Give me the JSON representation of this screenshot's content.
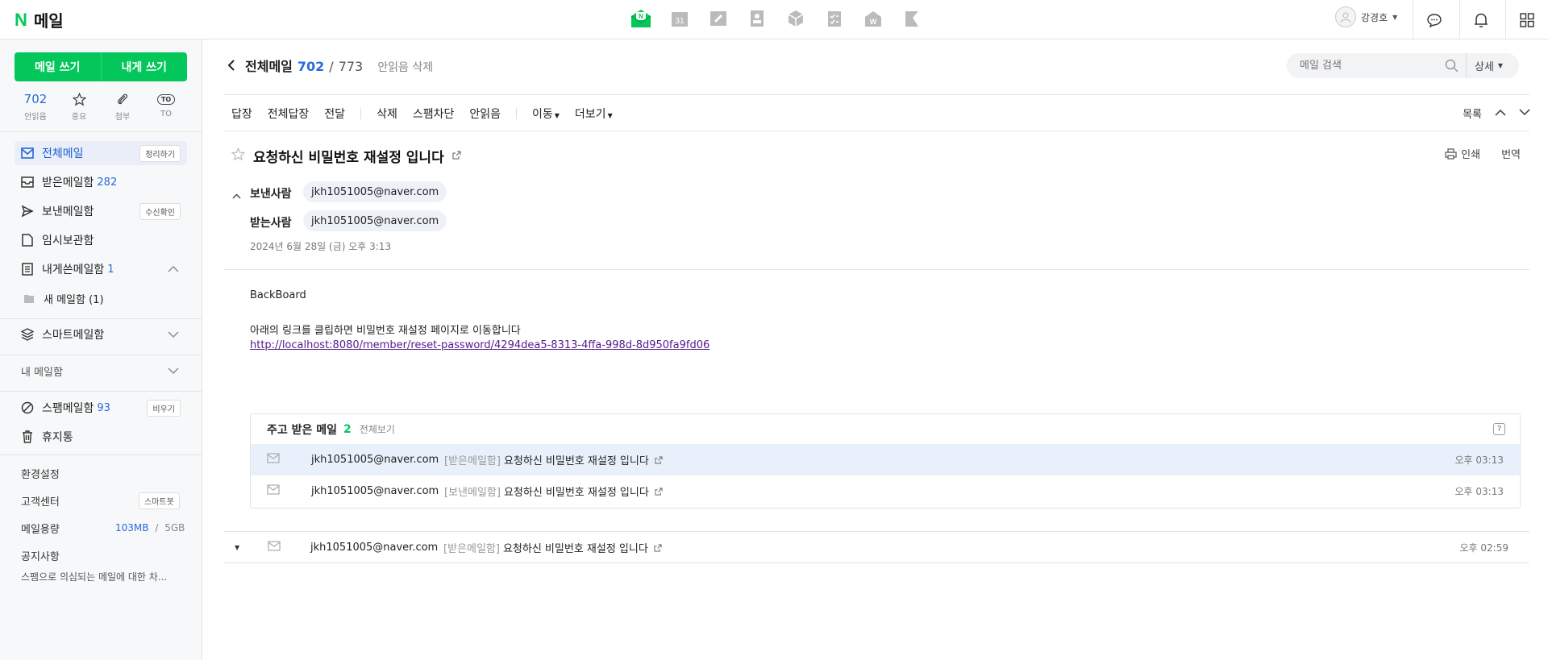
{
  "app": {
    "logo_n": "N",
    "logo_text": "메일",
    "user_name": "강경호"
  },
  "sidebar": {
    "write_mail": "메일 쓰기",
    "write_self": "내게 쓰기",
    "quick": [
      {
        "value": "702",
        "label": "안읽음"
      },
      {
        "label": "중요"
      },
      {
        "label": "첨부"
      },
      {
        "label": "TO",
        "badge": "TO"
      }
    ],
    "folders": {
      "all": {
        "label": "전체메일",
        "badge": "정리하기"
      },
      "inbox": {
        "label": "받은메일함",
        "count": "282"
      },
      "sent": {
        "label": "보낸메일함",
        "badge": "수신확인"
      },
      "drafts": {
        "label": "임시보관함"
      },
      "self": {
        "label": "내게쓴메일함",
        "count": "1"
      },
      "new_folder": {
        "label": "새 메일함 (1)"
      },
      "smart": {
        "label": "스마트메일함"
      },
      "my": {
        "label": "내 메일함"
      },
      "spam": {
        "label": "스팸메일함",
        "count": "93",
        "badge": "비우기"
      },
      "trash": {
        "label": "휴지통"
      }
    },
    "settings": "환경설정",
    "support": "고객센터",
    "support_badge": "스마트봇",
    "storage_label": "메일용량",
    "storage_used": "103MB",
    "storage_sep": "/",
    "storage_total": "5GB",
    "notice_label": "공지사항",
    "notice_text": "스팸으로 의심되는 메일에 대한 차..."
  },
  "header": {
    "folder_title": "전체메일",
    "unread": "702",
    "slash": "/",
    "total": "773",
    "unread_delete": "안읽음 삭제",
    "search_placeholder": "메일 검색",
    "search_detail": "상세"
  },
  "toolbar": {
    "reply": "답장",
    "reply_all": "전체답장",
    "forward": "전달",
    "delete": "삭제",
    "spam": "스팸차단",
    "mark_unread": "안읽음",
    "move": "이동",
    "more": "더보기",
    "list": "목록"
  },
  "message": {
    "subject": "요청하신 비밀번호 재설정 입니다",
    "print": "인쇄",
    "translate": "번역",
    "from_label": "보낸사람",
    "from": "jkh1051005@naver.com",
    "to_label": "받는사람",
    "to": "jkh1051005@naver.com",
    "date": "2024년 6월 28일 (금) 오후 3:13",
    "body_line1": "BackBoard",
    "body_line2": "아래의 링크를 클립하면 비밀번호 재설정 페이지로 이동합니다",
    "link": "http://localhost:8080/member/reset-password/4294dea5-8313-4ffa-998d-8d950fa9fd06"
  },
  "thread": {
    "title": "주고 받은 메일",
    "count": "2",
    "view_all": "전체보기",
    "help": "?",
    "rows": [
      {
        "sender": "jkh1051005@naver.com",
        "folder": "[받은메일함]",
        "subject": "요청하신 비밀번호 재설정 입니다",
        "time": "오후 03:13"
      },
      {
        "sender": "jkh1051005@naver.com",
        "folder": "[보낸메일함]",
        "subject": "요청하신 비밀번호 재설정 입니다",
        "time": "오후 03:13"
      }
    ]
  },
  "older": {
    "sender": "jkh1051005@naver.com",
    "folder": "[받은메일함]",
    "subject": "요청하신 비밀번호 재설정 입니다",
    "time": "오후 02:59"
  },
  "colors": {
    "brand": "#03c75a",
    "link_blue": "#2b6ad9",
    "highlight": "#e8f1fb"
  }
}
